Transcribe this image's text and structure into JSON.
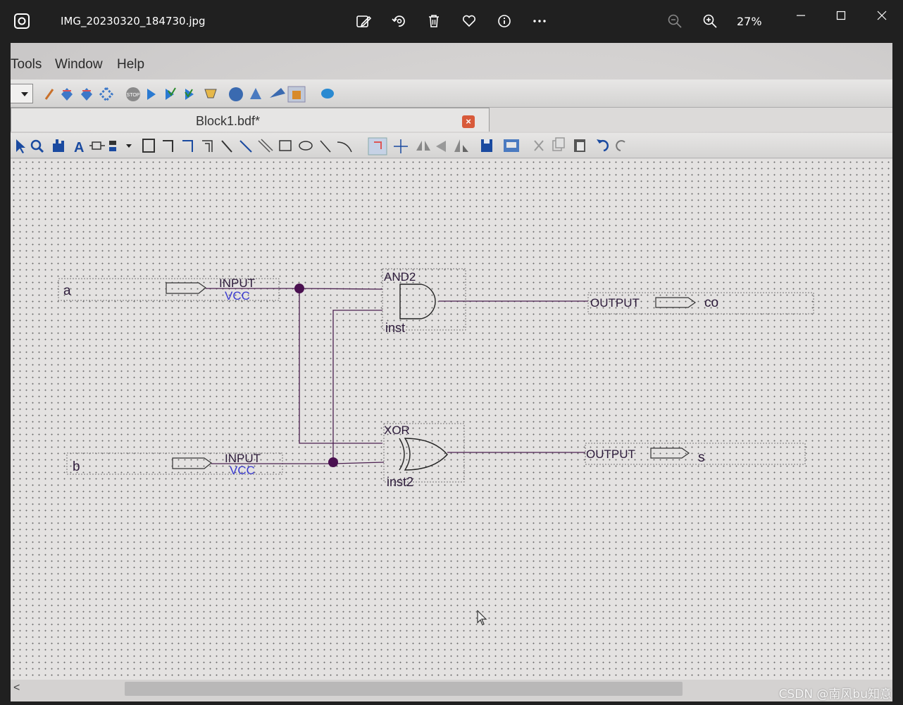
{
  "viewer": {
    "filename": "IMG_20230320_184730.jpg",
    "zoom_level": "27%",
    "toolbar_icons": [
      "edit-image-icon",
      "rotate-icon",
      "delete-icon",
      "favorite-icon",
      "info-icon",
      "more-icon"
    ],
    "zoom_icons": [
      "zoom-out-icon",
      "zoom-in-icon"
    ],
    "window_controls": [
      "minimize",
      "maximize",
      "close"
    ]
  },
  "screen": {
    "menu": {
      "tools": "Tools",
      "window": "Window",
      "help": "Help"
    },
    "tab_title": "Block1.bdf*",
    "tab_close": "×",
    "scroll_left": "<"
  },
  "schematic": {
    "input_a": {
      "name": "a",
      "type": "INPUT",
      "default": "VCC"
    },
    "input_b": {
      "name": "b",
      "type": "INPUT",
      "default": "VCC"
    },
    "and_gate": {
      "type": "AND2",
      "instance": "inst"
    },
    "xor_gate": {
      "type": "XOR",
      "instance": "inst2"
    },
    "output_co": {
      "type": "OUTPUT",
      "name": "co"
    },
    "output_s": {
      "type": "OUTPUT",
      "name": "s"
    },
    "wire_color": "#4a1f4f",
    "label_color": "#2c1a3a",
    "vcc_color": "#3a3ad0"
  },
  "watermark": "CSDN @南风bu知意"
}
